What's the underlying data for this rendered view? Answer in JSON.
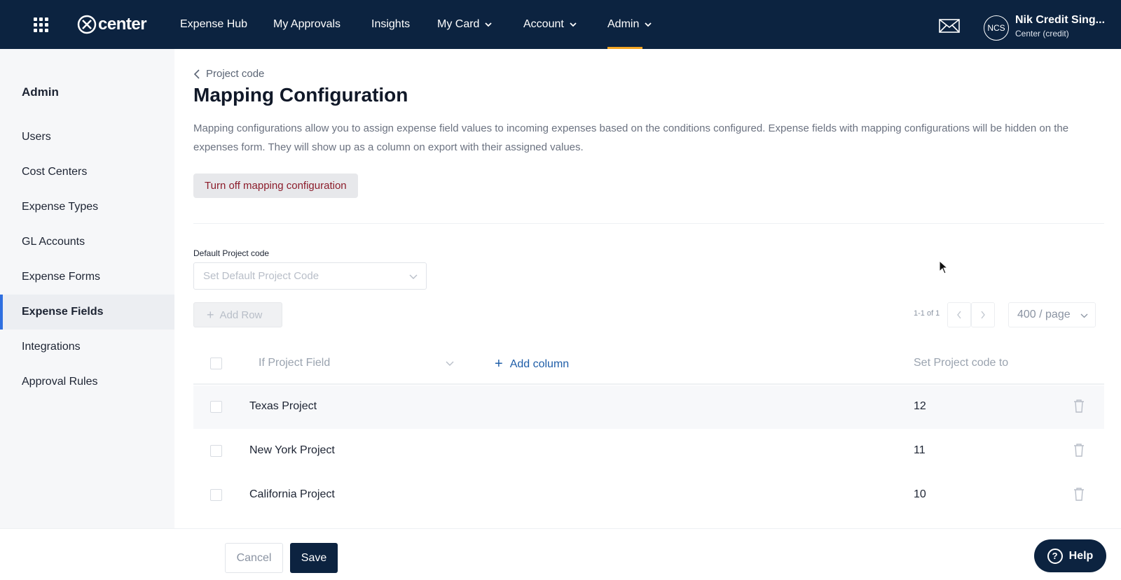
{
  "brand": {
    "name": "center"
  },
  "nav": {
    "items": [
      {
        "label": "Expense Hub"
      },
      {
        "label": "My Approvals"
      },
      {
        "label": "Insights"
      },
      {
        "label": "My Card"
      },
      {
        "label": "Account"
      },
      {
        "label": "Admin"
      }
    ],
    "active": "Admin"
  },
  "user": {
    "initials": "NCS",
    "name": "Nik Credit Sing...",
    "org": "Center (credit)"
  },
  "sidebar": {
    "title": "Admin",
    "items": [
      {
        "label": "Users"
      },
      {
        "label": "Cost Centers"
      },
      {
        "label": "Expense Types"
      },
      {
        "label": "GL Accounts"
      },
      {
        "label": "Expense Forms"
      },
      {
        "label": "Expense Fields"
      },
      {
        "label": "Integrations"
      },
      {
        "label": "Approval Rules"
      }
    ],
    "active": "Expense Fields"
  },
  "main": {
    "breadcrumb": "Project code",
    "title": "Mapping Configuration",
    "description": "Mapping configurations allow you to assign expense field values to incoming expenses based on the conditions configured. Expense fields with mapping configurations will be hidden on the expenses form. They will show up as a column on export with their assigned values.",
    "turn_off_label": "Turn off mapping configuration",
    "default_label": "Default Project code",
    "default_placeholder": "Set Default Project Code",
    "add_row_label": "Add Row",
    "pager": {
      "range": "1-1 of 1",
      "page_size": "400 / page"
    },
    "table": {
      "col_field": "If Project Field",
      "add_column": "Add column",
      "col_set": "Set Project code to",
      "rows": [
        {
          "name": "Texas Project",
          "value": "12"
        },
        {
          "name": "New York Project",
          "value": "11"
        },
        {
          "name": "California Project",
          "value": "10"
        }
      ]
    }
  },
  "footer": {
    "cancel": "Cancel",
    "save": "Save",
    "help": "Help"
  },
  "colors": {
    "navbar": "#0c2340",
    "accent": "#f5a623",
    "active_side": "#2f6fe0",
    "danger_text": "#8c1d2b",
    "link": "#1f5ea8"
  }
}
